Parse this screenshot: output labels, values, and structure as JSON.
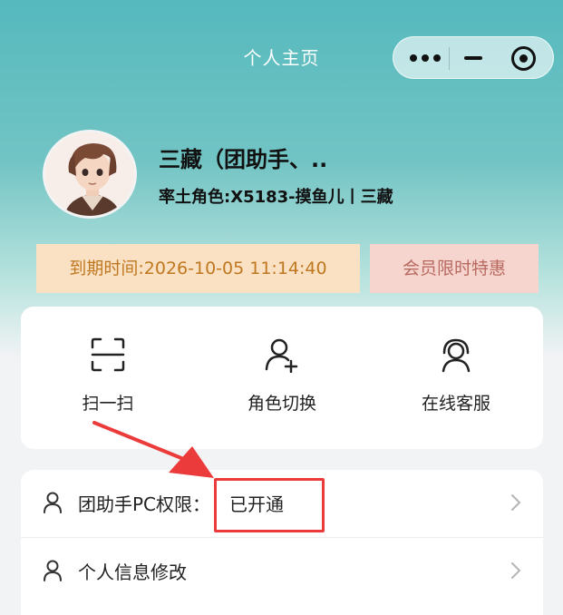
{
  "header": {
    "title": "个人主页",
    "capsule": {
      "more_icon": "more-dots-icon",
      "minimize_icon": "minimize-icon",
      "close_icon": "target-close-icon"
    }
  },
  "profile": {
    "name": "三藏（团助手、..",
    "role": "率土角色:X5183-摸鱼儿丨三藏",
    "avatar_icon": "anime-character-avatar"
  },
  "badges": {
    "expiry": "到期时间:2026-10-05 11:14:40",
    "vip_offer": "会员限时特惠"
  },
  "shortcuts": [
    {
      "label": "扫一扫",
      "icon": "scan-icon"
    },
    {
      "label": "角色切换",
      "icon": "user-add-icon"
    },
    {
      "label": "在线客服",
      "icon": "customer-service-icon"
    }
  ],
  "menu": [
    {
      "label": "团助手PC权限：",
      "value": "已开通",
      "icon": "user-icon"
    },
    {
      "label": "个人信息修改",
      "icon": "user-icon"
    }
  ],
  "annotation": {
    "color": "#ec3b3b"
  },
  "colors": {
    "header_teal": "#55b9bd",
    "expiry_bg": "#fae1c4",
    "expiry_text": "#c07820",
    "vip_bg": "#f7d5cf",
    "vip_text": "#b86a60"
  }
}
